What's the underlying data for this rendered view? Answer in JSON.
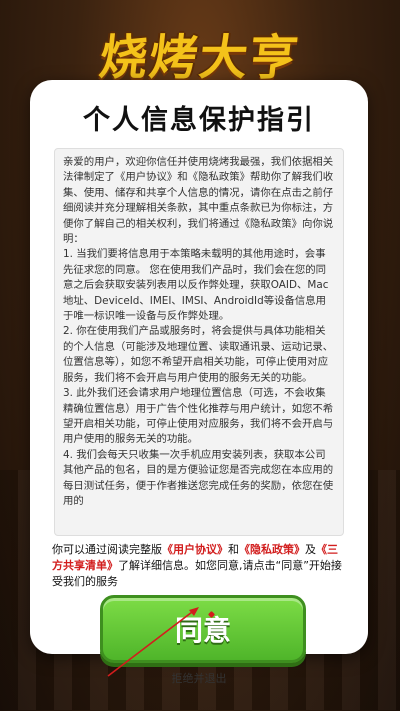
{
  "background": {
    "logo_text": "烧烤大亨"
  },
  "dialog": {
    "title": "个人信息保护指引",
    "terms_paragraphs": [
      "亲爱的用户，欢迎你信任并使用烧烤我最强，我们依据相关法律制定了《用户协议》和《隐私政策》帮助你了解我们收集、使用、储存和共享个人信息的情况，请你在点击之前仔细阅读并充分理解相关条款，其中重点条款已为你标注，方便你了解自己的相关权利，我们将通过《隐私政策》向你说明：",
      "1. 当我们要将信息用于本策略未载明的其他用途时，会事先征求您的同意。 您在使用我们产品时，我们会在您的同意之后会获取安装列表用以反作弊处理，获取OAID、Mac地址、DeviceId、IMEI、IMSI、AndroidId等设备信息用于唯一标识唯一设备与反作弊处理。",
      "2. 你在使用我们产品或服务时，将会提供与具体功能相关的个人信息（可能涉及地理位置、读取通讯录、运动记录、位置信息等），如您不希望开启相关功能，可停止使用对应服务，我们将不会开启与用户使用的服务无关的功能。",
      "3. 此外我们还会请求用户地理位置信息（可选，不会收集精确位置信息）用于广告个性化推荐与用户统计，如您不希望开启相关功能，可停止使用对应服务，我们将不会开启与用户使用的服务无关的功能。",
      "4. 我们会每天只收集一次手机应用安装列表，获取本公司其他产品的包名，目的是方便验证您是否完成您在本应用的每日测试任务，便于作者推送您完成任务的奖励，依您在使用的"
    ],
    "notice": {
      "prefix": "你可以通过阅读完整版",
      "link_agreement": "《用户协议》",
      "and": "和",
      "link_privacy": "《隐私政策》",
      "and2": "及",
      "link_sharing": "《三方共享清单》",
      "suffix": "了解详细信息。如您同意,请点击“同意”开始接受我们的服务"
    },
    "agree_label": "同意",
    "reject_label": "拒绝并退出"
  }
}
